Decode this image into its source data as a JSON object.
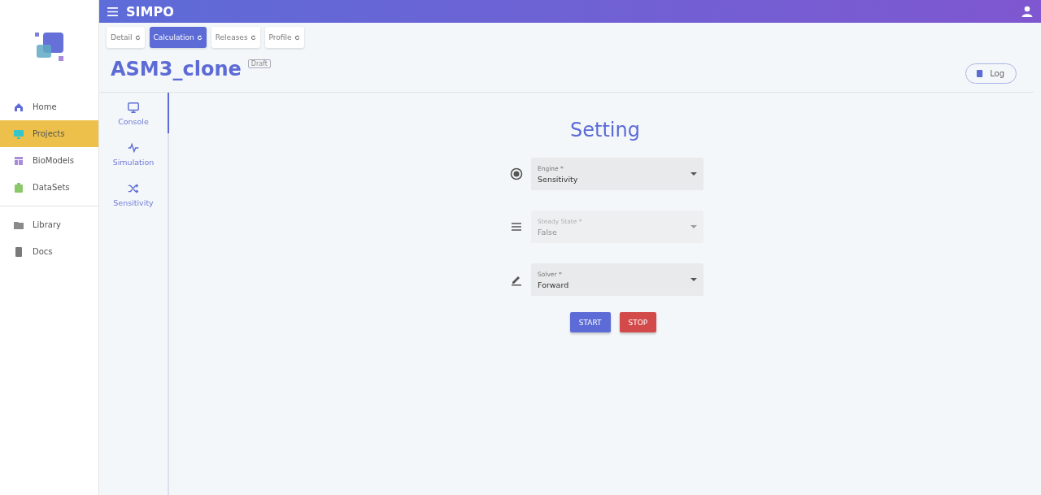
{
  "app_bar": {
    "title": "SIMPO"
  },
  "sidebar": {
    "main_items": [
      {
        "label": "Home",
        "kind": "home",
        "color": "#5c6bd6",
        "selected": false
      },
      {
        "label": "Projects",
        "kind": "monitor",
        "color": "#36c5c9",
        "selected": true
      },
      {
        "label": "BioModels",
        "kind": "table",
        "color": "#a98bd9",
        "selected": false
      },
      {
        "label": "DataSets",
        "kind": "clipboard",
        "color": "#8bc86a",
        "selected": false
      }
    ],
    "secondary_items": [
      {
        "label": "Library",
        "kind": "folder",
        "color": "#8a8a8a",
        "selected": false
      },
      {
        "label": "Docs",
        "kind": "book",
        "color": "#7a7a7a",
        "selected": false
      }
    ]
  },
  "tabs": [
    {
      "label": "Detail",
      "selected": false
    },
    {
      "label": "Calculation",
      "selected": true
    },
    {
      "label": "Releases",
      "selected": false
    },
    {
      "label": "Profile",
      "selected": false
    }
  ],
  "project": {
    "name": "ASM3_clone",
    "badge": "Draft",
    "log_button": "Log"
  },
  "side_tabs": [
    {
      "label": "Console",
      "kind": "monitor",
      "selected": true
    },
    {
      "label": "Simulation",
      "kind": "wave",
      "selected": false
    },
    {
      "label": "Sensitivity",
      "kind": "shuffle",
      "selected": false
    }
  ],
  "setting": {
    "title": "Setting",
    "fields": [
      {
        "label": "Engine *",
        "value": "Sensitivity",
        "kind": "radio",
        "disabled": false
      },
      {
        "label": "Steady State *",
        "value": "False",
        "kind": "lines",
        "disabled": true
      },
      {
        "label": "Solver *",
        "value": "Forward",
        "kind": "pencil",
        "disabled": false
      }
    ],
    "start_button": "START",
    "stop_button": "STOP"
  }
}
